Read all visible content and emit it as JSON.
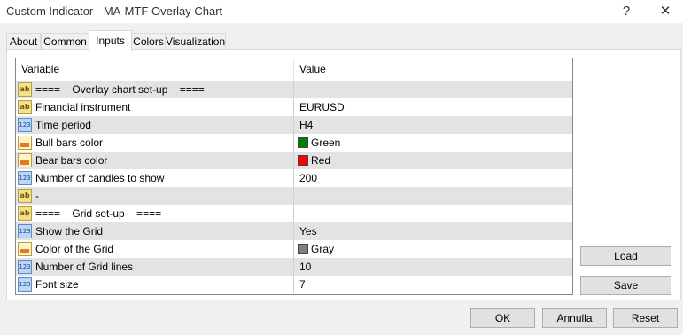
{
  "window": {
    "title": "Custom Indicator - MA-MTF Overlay Chart",
    "help_symbol": "?",
    "close_symbol": "✕"
  },
  "tabs": [
    {
      "label": "About"
    },
    {
      "label": "Common"
    },
    {
      "label": "Inputs"
    },
    {
      "label": "Colors"
    },
    {
      "label": "Visualization"
    }
  ],
  "grid": {
    "headers": {
      "variable": "Variable",
      "value": "Value"
    },
    "rows": [
      {
        "icon": "string-type-icon",
        "label": "====    Overlay chart set-up    ====",
        "value": ""
      },
      {
        "icon": "string-type-icon",
        "label": "Financial instrument",
        "value": "EURUSD"
      },
      {
        "icon": "integer-type-icon",
        "label": "Time period",
        "value": "H4"
      },
      {
        "icon": "color-type-icon",
        "label": "Bull bars color",
        "value": "Green",
        "swatch": "#008000"
      },
      {
        "icon": "color-type-icon",
        "label": "Bear bars color",
        "value": "Red",
        "swatch": "#ff0000"
      },
      {
        "icon": "integer-type-icon",
        "label": "Number of candles to show",
        "value": "200"
      },
      {
        "icon": "string-type-icon",
        "label": "-",
        "value": ""
      },
      {
        "icon": "string-type-icon",
        "label": "====    Grid set-up    ====",
        "value": ""
      },
      {
        "icon": "integer-type-icon",
        "label": "Show the Grid",
        "value": "Yes"
      },
      {
        "icon": "color-type-icon",
        "label": "Color of the Grid",
        "value": "Gray",
        "swatch": "#808080"
      },
      {
        "icon": "integer-type-icon",
        "label": "Number of Grid lines",
        "value": "10"
      },
      {
        "icon": "integer-type-icon",
        "label": "Font size",
        "value": "7"
      }
    ]
  },
  "side_buttons": {
    "load": "Load",
    "save": "Save"
  },
  "footer_buttons": {
    "ok": "OK",
    "cancel": "Annulla",
    "reset": "Reset"
  },
  "icons": {
    "string": "ab",
    "integer": "123"
  }
}
